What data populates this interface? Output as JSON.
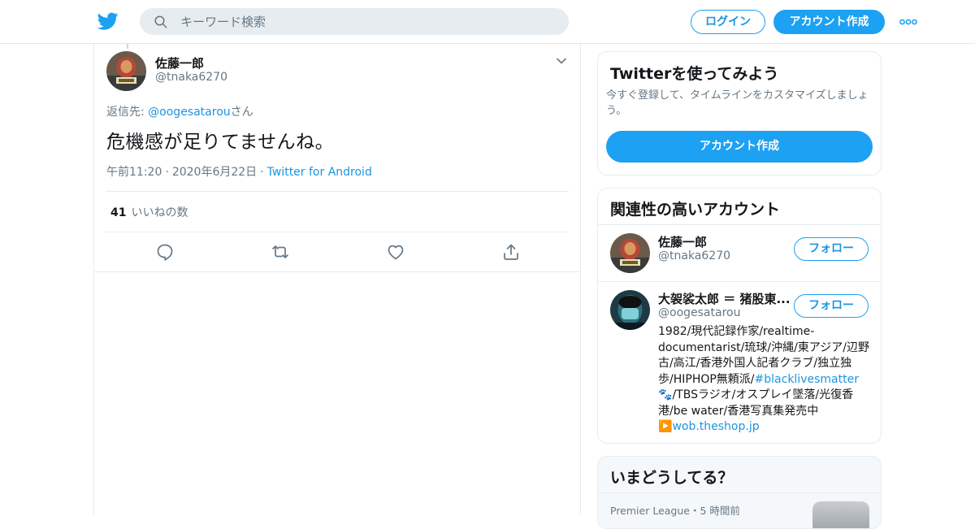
{
  "header": {
    "search_placeholder": "キーワード検索",
    "login_label": "ログイン",
    "signup_label": "アカウント作成",
    "brand_color": "#1da1f2"
  },
  "tweet": {
    "author_name": "佐藤一郎",
    "author_handle": "@tnaka6270",
    "reply_prefix": "返信先: ",
    "reply_handle": "@oogesatarou",
    "reply_suffix": "さん",
    "text": "危機感が足りてませんね。",
    "time": "午前11:20",
    "date": "2020年6月22日",
    "source": "Twitter for Android",
    "likes_count": "41",
    "likes_label": "いいねの数",
    "actions": [
      "reply-icon",
      "retweet-icon",
      "like-icon",
      "share-icon"
    ]
  },
  "sidebar": {
    "signup_card": {
      "title": "Twitterを使ってみよう",
      "description": "今すぐ登録して、タイムラインをカスタマイズしましょう。",
      "button_label": "アカウント作成"
    },
    "related": {
      "title": "関連性の高いアカウント",
      "accounts": [
        {
          "name": "佐藤一郎",
          "handle": "@tnaka6270",
          "follow_label": "フォロー"
        },
        {
          "name": "大袈裟太郎 ＝ 猪股東...",
          "handle": "@oogesatarou",
          "follow_label": "フォロー",
          "bio_1": "1982/現代記録作家/realtime-documentarist/琉球/沖縄/東アジア/辺野古/高江/香港外国人記者クラブ/独立独歩/HIPHOP無頼派/",
          "bio_hashtag": "#blacklivesmatter",
          "bio_emoji": "🐾",
          "bio_2": "/TBSラジオ/オスプレイ墜落/光復香港/be water/香港写真集発売中",
          "bio_link_icon": "▶️",
          "bio_link": "wob.theshop.jp"
        }
      ]
    },
    "trends": {
      "title": "いまどうしてる？",
      "first_trend_meta": "Premier League・5 時間前"
    }
  }
}
